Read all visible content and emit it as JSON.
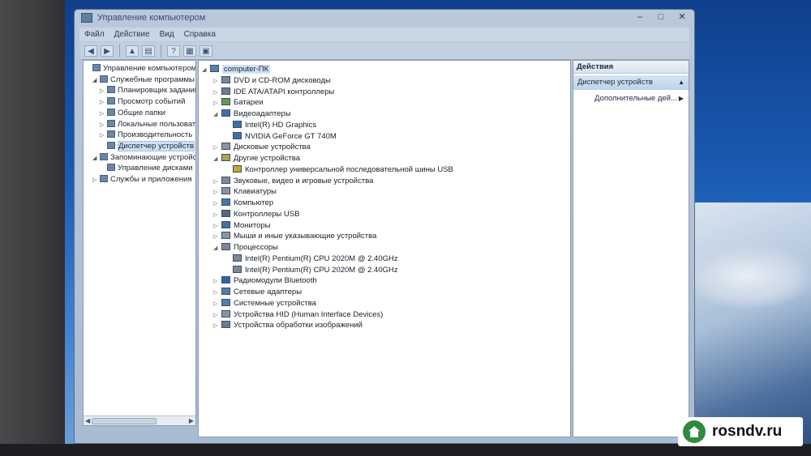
{
  "window": {
    "title": "Управление компьютером",
    "controls": {
      "minimize": "–",
      "maximize": "□",
      "close": "✕"
    }
  },
  "menu": [
    "Файл",
    "Действие",
    "Вид",
    "Справка"
  ],
  "toolbar": [
    "back-arrow-icon",
    "forward-arrow-icon",
    "folder-up-icon",
    "console-tree-icon",
    "help-icon",
    "properties-icon",
    "show-hide-icon"
  ],
  "left_tree": [
    {
      "label": "Управление компьютером (л",
      "level": 0,
      "arrow": ""
    },
    {
      "label": "Служебные программы",
      "level": 1,
      "arrow": "◢"
    },
    {
      "label": "Планировщик заданий",
      "level": 2,
      "arrow": "▷"
    },
    {
      "label": "Просмотр событий",
      "level": 2,
      "arrow": "▷"
    },
    {
      "label": "Общие папки",
      "level": 2,
      "arrow": "▷"
    },
    {
      "label": "Локальные пользоват",
      "level": 2,
      "arrow": "▷"
    },
    {
      "label": "Производительность",
      "level": 2,
      "arrow": "▷"
    },
    {
      "label": "Диспетчер устройств",
      "level": 2,
      "arrow": "",
      "selected": true
    },
    {
      "label": "Запоминающие устройст",
      "level": 1,
      "arrow": "◢"
    },
    {
      "label": "Управление дисками",
      "level": 2,
      "arrow": ""
    },
    {
      "label": "Службы и приложения",
      "level": 1,
      "arrow": "▷"
    }
  ],
  "device_tree": [
    {
      "label": "computer-ПК",
      "level": 0,
      "arrow": "◢",
      "color": "#5a7fa8"
    },
    {
      "label": "DVD и CD-ROM дисководы",
      "level": 1,
      "arrow": "▷",
      "color": "#7a8899"
    },
    {
      "label": "IDE ATA/ATAPI контроллеры",
      "level": 1,
      "arrow": "▷",
      "color": "#6d7c8d"
    },
    {
      "label": "Батареи",
      "level": 1,
      "arrow": "▷",
      "color": "#5e9c4b"
    },
    {
      "label": "Видеоадаптеры",
      "level": 1,
      "arrow": "◢",
      "color": "#3f6fa8"
    },
    {
      "label": "Intel(R) HD Graphics",
      "level": 2,
      "arrow": "",
      "color": "#3f6fa8"
    },
    {
      "label": "NVIDIA GeForce GT 740M",
      "level": 2,
      "arrow": "",
      "color": "#3f6fa8"
    },
    {
      "label": "Дисковые устройства",
      "level": 1,
      "arrow": "▷",
      "color": "#8a95a3"
    },
    {
      "label": "Другие устройства",
      "level": 1,
      "arrow": "◢",
      "color": "#b3a24a"
    },
    {
      "label": "Контроллер универсальной последовательной шины USB",
      "level": 2,
      "arrow": "",
      "color": "#c9a531"
    },
    {
      "label": "Звуковые, видео и игровые устройства",
      "level": 1,
      "arrow": "▷",
      "color": "#7d8a98"
    },
    {
      "label": "Клавиатуры",
      "level": 1,
      "arrow": "▷",
      "color": "#8a95a3"
    },
    {
      "label": "Компьютер",
      "level": 1,
      "arrow": "▷",
      "color": "#4e75a3"
    },
    {
      "label": "Контроллеры USB",
      "level": 1,
      "arrow": "▷",
      "color": "#59677a"
    },
    {
      "label": "Мониторы",
      "level": 1,
      "arrow": "▷",
      "color": "#3f6fa8"
    },
    {
      "label": "Мыши и иные указывающие устройства",
      "level": 1,
      "arrow": "▷",
      "color": "#8a95a3"
    },
    {
      "label": "Процессоры",
      "level": 1,
      "arrow": "◢",
      "color": "#7e8796"
    },
    {
      "label": "Intel(R) Pentium(R) CPU 2020M @ 2.40GHz",
      "level": 2,
      "arrow": "",
      "color": "#7e8796"
    },
    {
      "label": "Intel(R) Pentium(R) CPU 2020M @ 2.40GHz",
      "level": 2,
      "arrow": "",
      "color": "#7e8796"
    },
    {
      "label": "Радиомодули Bluetooth",
      "level": 1,
      "arrow": "▷",
      "color": "#2f63b8"
    },
    {
      "label": "Сетевые адаптеры",
      "level": 1,
      "arrow": "▷",
      "color": "#4f7fb0"
    },
    {
      "label": "Системные устройства",
      "level": 1,
      "arrow": "▷",
      "color": "#4f7fb0"
    },
    {
      "label": "Устройства HID (Human Interface Devices)",
      "level": 1,
      "arrow": "▷",
      "color": "#8a95a3"
    },
    {
      "label": "Устройства обработки изображений",
      "level": 1,
      "arrow": "▷",
      "color": "#6d7c8d"
    }
  ],
  "actions": {
    "header": "Действия",
    "section": "Диспетчер устройств",
    "item": "Дополнительные дей..."
  },
  "watermark": "rosndv.ru"
}
